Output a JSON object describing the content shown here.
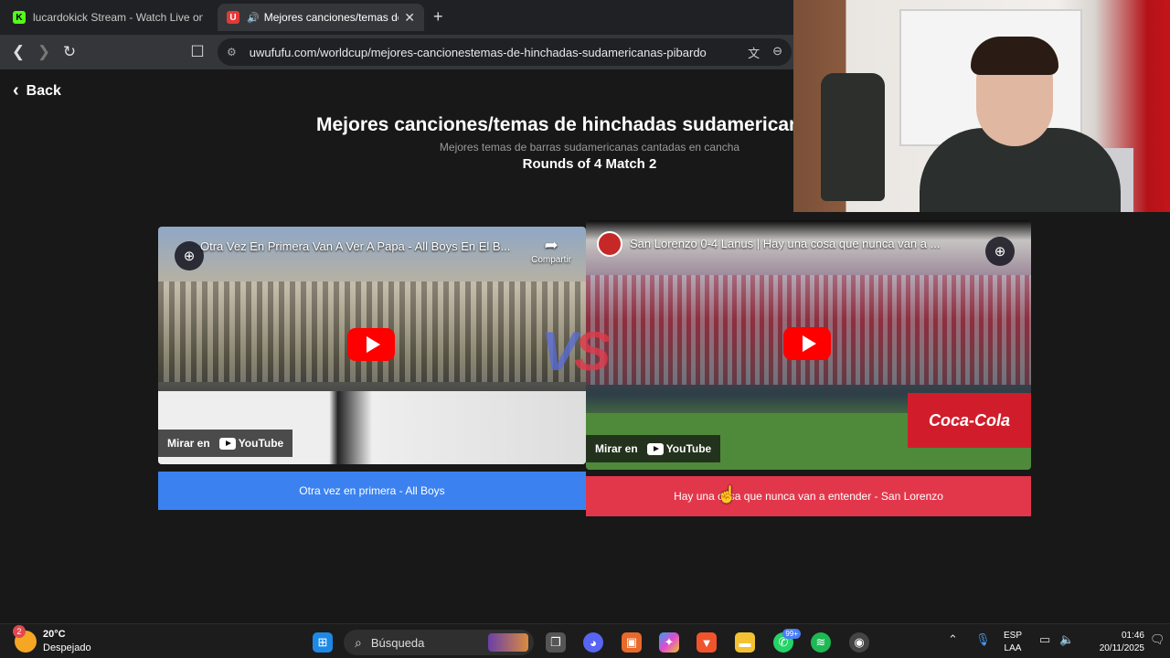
{
  "browser": {
    "tabs": [
      {
        "title": "lucardokick Stream - Watch Live on K",
        "favicon": "K"
      },
      {
        "title": "Mejores canciones/temas de",
        "favicon": "U"
      }
    ],
    "new_tab": "+",
    "url": "uwufufu.com/worldcup/mejores-cancionestemas-de-hinchadas-sudamericanas-pibardo"
  },
  "page": {
    "back_label": "Back",
    "title": "Mejores canciones/temas de hinchadas sudamericanas",
    "subtitle": "Mejores temas de barras sudamericanas cantadas en cancha",
    "round": "Rounds of 4 Match 2",
    "vs": {
      "v": "V",
      "s": "S"
    },
    "left": {
      "video_title": "Otra Vez En Primera Van A Ver A Papa - All Boys En El B...",
      "share_label": "Compartir",
      "watch_label": "Mirar en",
      "youtube_label": "YouTube",
      "choice": "Otra vez en primera - All Boys",
      "color": "#3b82f0"
    },
    "right": {
      "video_title": "San Lorenzo 0-4 Lanus | Hay una cosa que nunca van a ...",
      "watch_label": "Mirar en",
      "youtube_label": "YouTube",
      "ad_text": "Coca-Cola",
      "choice": "Hay una cosa que nunca van a entender - San Lorenzo",
      "color": "#e2374b"
    }
  },
  "taskbar": {
    "weather_badge": "2",
    "temperature": "20°C",
    "condition": "Despejado",
    "search_label": "Búsqueda",
    "whatsapp_badge": "99+",
    "lang_top": "ESP",
    "lang_bottom": "LAA",
    "time": "01:46",
    "date": "20/11/2025"
  }
}
